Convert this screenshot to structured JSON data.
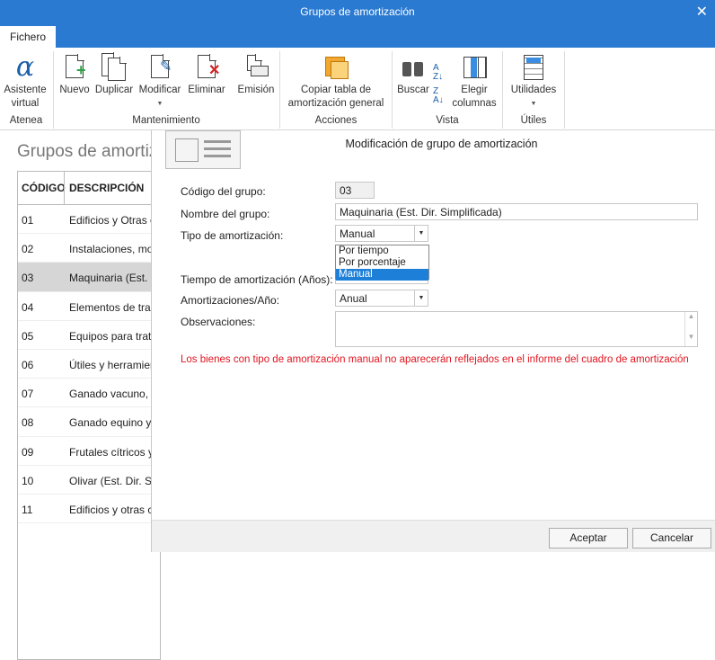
{
  "window": {
    "title": "Grupos de amortización"
  },
  "tabs": [
    "Fichero"
  ],
  "ribbon": {
    "buttons": {
      "asistente": "Asistente virtual",
      "nuevo": "Nuevo",
      "duplicar": "Duplicar",
      "modificar": "Modificar",
      "eliminar": "Eliminar",
      "emision": "Emisión",
      "copiar": "Copiar tabla de amortización general",
      "buscar": "Buscar",
      "elegir": "Elegir columnas",
      "utilidades": "Utilidades"
    },
    "groups": {
      "atenea": "Atenea",
      "mantenimiento": "Mantenimiento",
      "acciones": "Acciones",
      "vista": "Vista",
      "utiles": "Útiles"
    }
  },
  "list": {
    "title": "Grupos de amortización",
    "columns": [
      "CÓDIGO",
      "DESCRIPCIÓN"
    ],
    "rows": [
      {
        "code": "01",
        "desc": "Edificios y Otras construcciones"
      },
      {
        "code": "02",
        "desc": "Instalaciones, mobiliario"
      },
      {
        "code": "03",
        "desc": "Maquinaria (Est. Dir. Simplificada)"
      },
      {
        "code": "04",
        "desc": "Elementos de transporte"
      },
      {
        "code": "05",
        "desc": "Equipos para tratamiento"
      },
      {
        "code": "06",
        "desc": "Útiles y herramientas"
      },
      {
        "code": "07",
        "desc": "Ganado vacuno, porcino"
      },
      {
        "code": "08",
        "desc": "Ganado equino y"
      },
      {
        "code": "09",
        "desc": "Frutales cítricos y"
      },
      {
        "code": "10",
        "desc": "Olivar (Est. Dir. Simplificada)"
      },
      {
        "code": "11",
        "desc": "Edificios y otras construcciones"
      }
    ],
    "selected_index": 2
  },
  "dialog": {
    "title": "Modificación de grupo de amortización",
    "labels": {
      "codigo": "Código del grupo:",
      "nombre": "Nombre del grupo:",
      "tipo": "Tipo de amortización:",
      "tiempo": "Tiempo de amortización (Años):",
      "amort_anio": "Amortizaciones/Año:",
      "observaciones": "Observaciones:"
    },
    "values": {
      "codigo": "03",
      "nombre": "Maquinaria (Est. Dir. Simplificada)",
      "tipo": "Manual",
      "amort_anio": "Anual",
      "observaciones": ""
    },
    "tipo_options": [
      "Por tiempo",
      "Por porcentaje",
      "Manual"
    ],
    "warning": "Los bienes con tipo de amortización manual no aparecerán reflejados en el informe del cuadro de amortización",
    "buttons": {
      "ok": "Aceptar",
      "cancel": "Cancelar"
    }
  },
  "colors": {
    "titlebar": "#2b7ad1",
    "warning": "#e0141e",
    "selection": "#1e7fd8"
  }
}
